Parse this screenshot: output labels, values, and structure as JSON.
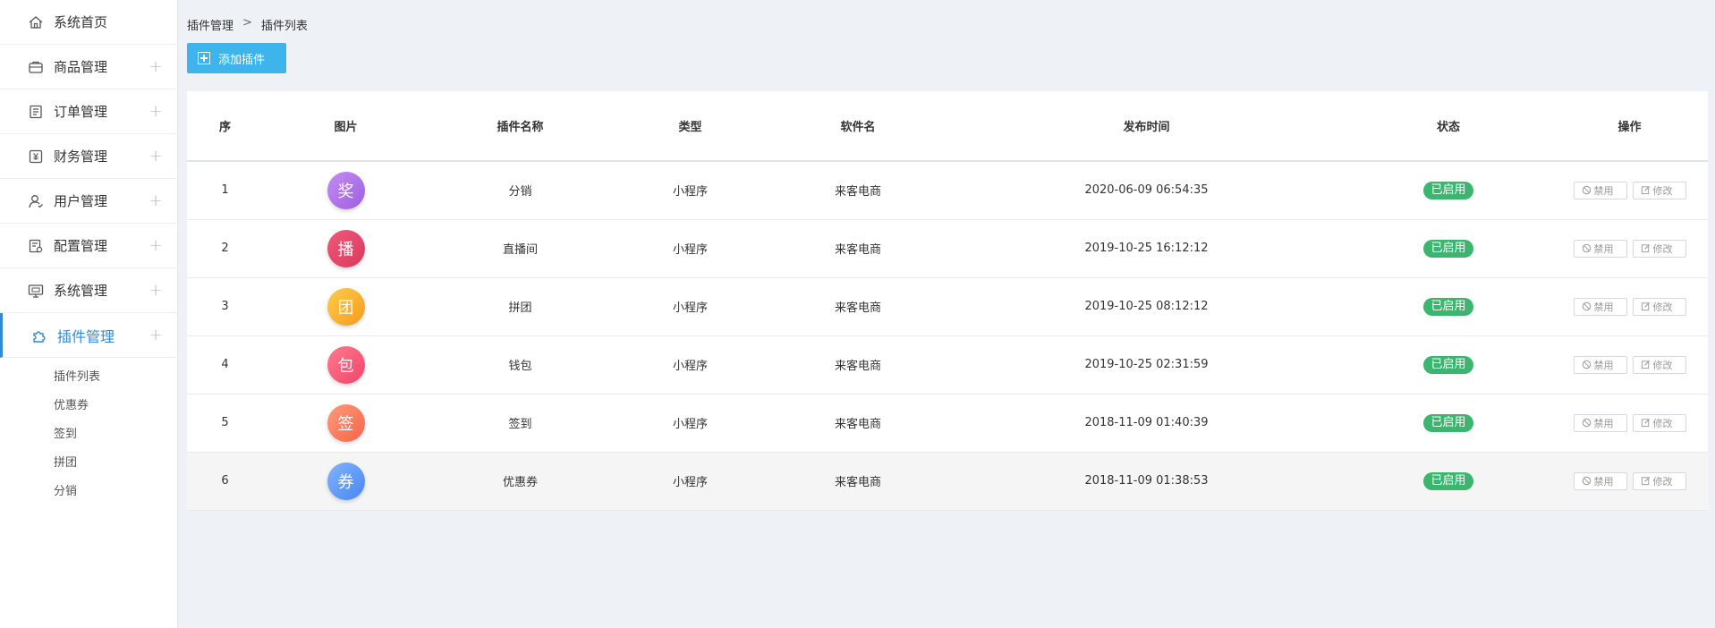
{
  "sidebar": {
    "items": [
      {
        "label": "系统首页",
        "icon": "home-icon",
        "expandable": false
      },
      {
        "label": "商品管理",
        "icon": "bag-icon",
        "expandable": true
      },
      {
        "label": "订单管理",
        "icon": "order-icon",
        "expandable": true
      },
      {
        "label": "财务管理",
        "icon": "finance-icon",
        "expandable": true
      },
      {
        "label": "用户管理",
        "icon": "user-icon",
        "expandable": true
      },
      {
        "label": "配置管理",
        "icon": "config-icon",
        "expandable": true
      },
      {
        "label": "系统管理",
        "icon": "monitor-icon",
        "expandable": true
      },
      {
        "label": "插件管理",
        "icon": "puzzle-icon",
        "expandable": true,
        "active": true
      }
    ],
    "plus": "+",
    "submenu": [
      "插件列表",
      "优惠券",
      "签到",
      "拼团",
      "分销"
    ]
  },
  "breadcrumb": {
    "parent": "插件管理",
    "sep": ">",
    "current": "插件列表"
  },
  "toolbar": {
    "add_label": "添加插件"
  },
  "table": {
    "headers": {
      "idx": "序",
      "img": "图片",
      "name": "插件名称",
      "type": "类型",
      "soft": "软件名",
      "time": "发布时间",
      "status": "状态",
      "op": "操作"
    },
    "disable_label": "禁用",
    "edit_label": "修改",
    "rows": [
      {
        "idx": "1",
        "icon_char": "奖",
        "color_from": "#c58cf2",
        "color_to": "#9b5fe0",
        "name": "分销",
        "type": "小程序",
        "soft": "来客电商",
        "time": "2020-06-09 06:54:35",
        "status": "已启用"
      },
      {
        "idx": "2",
        "icon_char": "播",
        "color_from": "#f0587a",
        "color_to": "#d93a5c",
        "name": "直播间",
        "type": "小程序",
        "soft": "来客电商",
        "time": "2019-10-25 16:12:12",
        "status": "已启用"
      },
      {
        "idx": "3",
        "icon_char": "团",
        "color_from": "#ffcc4d",
        "color_to": "#f59a1c",
        "name": "拼团",
        "type": "小程序",
        "soft": "来客电商",
        "time": "2019-10-25 08:12:12",
        "status": "已启用"
      },
      {
        "idx": "4",
        "icon_char": "包",
        "color_from": "#ff7a8e",
        "color_to": "#f0456a",
        "name": "钱包",
        "type": "小程序",
        "soft": "来客电商",
        "time": "2019-10-25 02:31:59",
        "status": "已启用"
      },
      {
        "idx": "5",
        "icon_char": "签",
        "color_from": "#ff9b7a",
        "color_to": "#f5634a",
        "name": "签到",
        "type": "小程序",
        "soft": "来客电商",
        "time": "2018-11-09 01:40:39",
        "status": "已启用"
      },
      {
        "idx": "6",
        "icon_char": "券",
        "color_from": "#7fb4ff",
        "color_to": "#4a86f0",
        "name": "优惠券",
        "type": "小程序",
        "soft": "来客电商",
        "time": "2018-11-09 01:38:53",
        "status": "已启用"
      }
    ]
  },
  "colors": {
    "accent": "#2f8bd8",
    "add_button": "#3db4ec",
    "status_badge": "#3cb56e"
  }
}
